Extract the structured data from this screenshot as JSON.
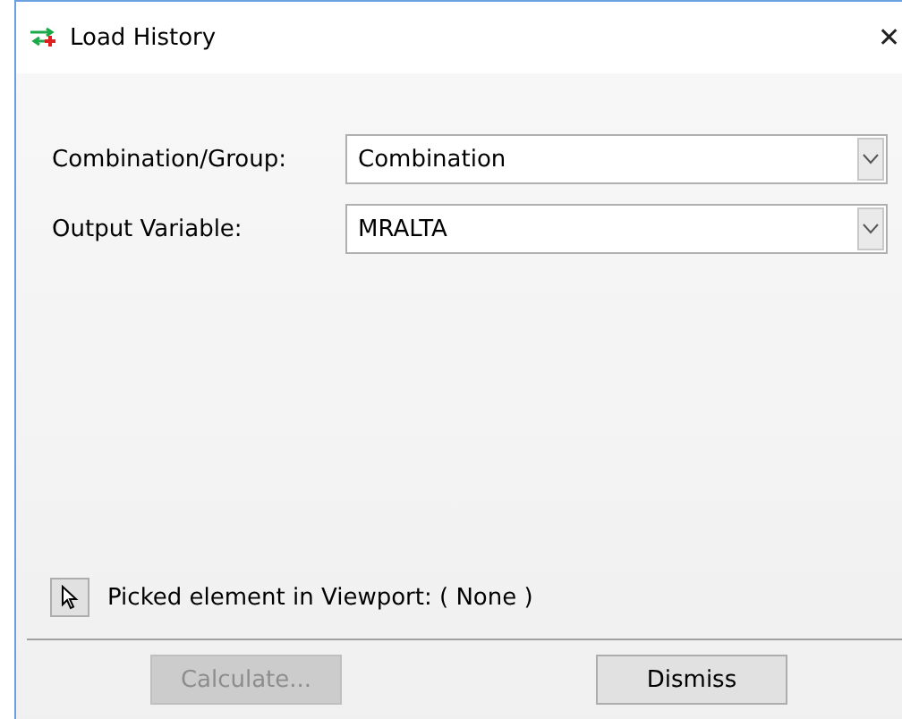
{
  "window": {
    "title": "Load History",
    "close": "✕"
  },
  "fields": [
    {
      "label": "Combination/Group:",
      "value": "Combination"
    },
    {
      "label": "Output Variable:",
      "value": "MRALTA"
    }
  ],
  "picked_element": {
    "text": "Picked element in Viewport: ( None )"
  },
  "buttons": [
    {
      "label": "Calculate...",
      "disabled": true
    },
    {
      "label": "Dismiss",
      "disabled": false
    }
  ]
}
